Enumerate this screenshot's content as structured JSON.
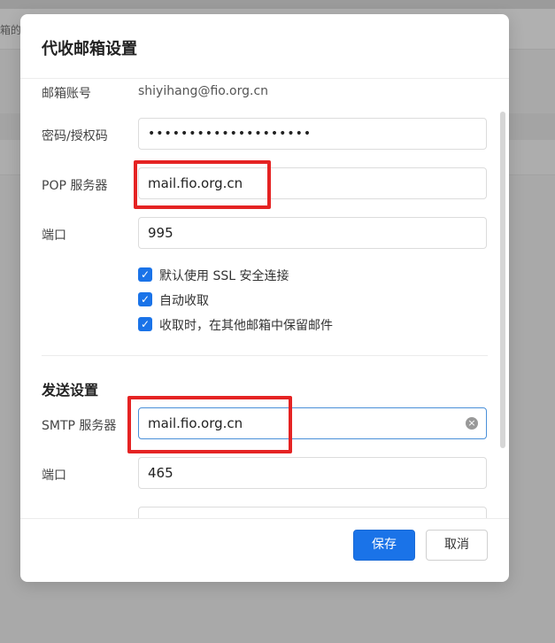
{
  "background": {
    "partial_text": "箱的邮"
  },
  "dialog": {
    "title": "代收邮箱设置",
    "account": {
      "label": "邮箱账号",
      "value": "shiyihang@fio.org.cn"
    },
    "password": {
      "label": "密码/授权码",
      "masked_value": "••••••••••••••••••••"
    },
    "pop_server": {
      "label": "POP 服务器",
      "value": "mail.fio.org.cn"
    },
    "pop_port": {
      "label": "端口",
      "value": "995"
    },
    "options": [
      {
        "label": "默认使用 SSL 安全连接",
        "checked": true
      },
      {
        "label": "自动收取",
        "checked": true
      },
      {
        "label": "收取时，在其他邮箱中保留邮件",
        "checked": true
      }
    ],
    "send_section": {
      "title": "发送设置",
      "smtp_server": {
        "label": "SMTP 服务器",
        "value": "mail.fio.org.cn"
      },
      "smtp_port": {
        "label": "端口",
        "value": "465"
      }
    },
    "buttons": {
      "save": "保存",
      "cancel": "取消"
    }
  },
  "colors": {
    "accent": "#1a73e8",
    "highlight": "#e52323",
    "overlay": "#a9a9a9"
  },
  "icons": {
    "check": "check-icon",
    "clear": "clear-icon"
  }
}
